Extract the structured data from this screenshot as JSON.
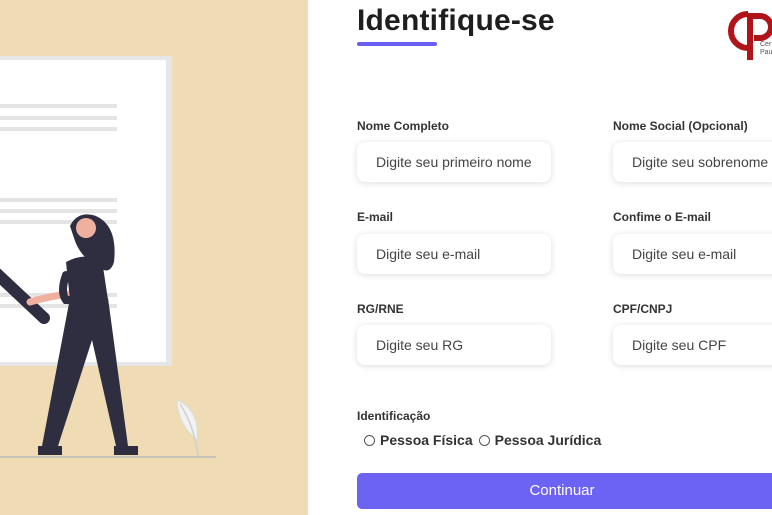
{
  "page": {
    "title": "Identifique-se",
    "accent_color": "#6c63f5"
  },
  "logo": {
    "letters": "CP",
    "text_line1": "Cer",
    "text_line2": "Pau",
    "color": "#b01318"
  },
  "form": {
    "fields": [
      {
        "label": "Nome Completo",
        "placeholder": "Digite seu primeiro nome"
      },
      {
        "label": "Nome Social (Opcional)",
        "placeholder": "Digite seu sobrenome"
      },
      {
        "label": "E-mail",
        "placeholder": "Digite seu e-mail"
      },
      {
        "label": "Confime o E-mail",
        "placeholder": "Digite seu e-mail"
      },
      {
        "label": "RG/RNE",
        "placeholder": "Digite seu RG"
      },
      {
        "label": "CPF/CNPJ",
        "placeholder": "Digite seu CPF"
      }
    ],
    "identification": {
      "label": "Identificação",
      "options": [
        "Pessoa Física",
        "Pessoa Jurídica"
      ]
    },
    "submit_label": "Continuar"
  },
  "illustration": {
    "icon": "person-holding-document-illustration",
    "background_color": "#f0dcb4"
  }
}
